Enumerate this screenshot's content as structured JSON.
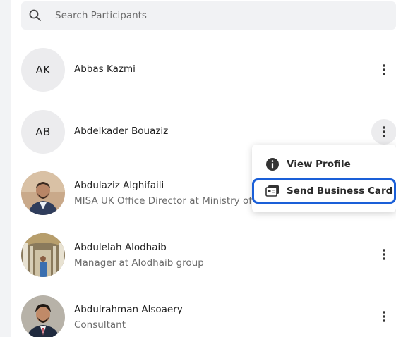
{
  "search": {
    "placeholder": "Search Participants",
    "icon": "search-icon"
  },
  "participants": [
    {
      "initials": "AK",
      "name": "Abbas Kazmi",
      "subtitle": ""
    },
    {
      "initials": "AB",
      "name": "Abdelkader Bouaziz",
      "subtitle": ""
    },
    {
      "initials": "",
      "name": "Abdulaziz Alghifaili",
      "subtitle": "MISA UK Office Director at Ministry of Investment"
    },
    {
      "initials": "",
      "name": "Abdulelah Alodhaib",
      "subtitle": "Manager at Alodhaib group"
    },
    {
      "initials": "",
      "name": "Abdulrahman Alsoaery",
      "subtitle": "Consultant"
    }
  ],
  "context_menu": {
    "items": [
      {
        "label": "View Profile",
        "icon": "info-icon"
      },
      {
        "label": "Send Business Card",
        "icon": "business-card-icon"
      }
    ]
  },
  "colors": {
    "highlight": "#1a5fd8",
    "avatar_bg": "#ececee",
    "search_bg": "#f1f2f4"
  }
}
